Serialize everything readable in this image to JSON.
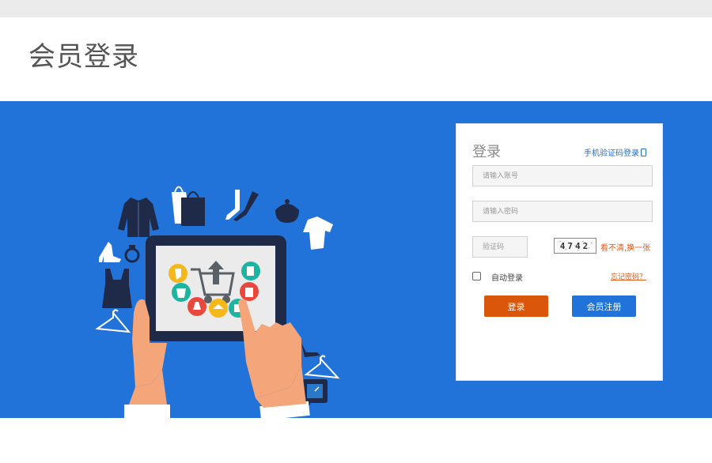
{
  "header": {
    "title": "会员登录"
  },
  "login": {
    "title": "登录",
    "sms_link": "手机验证码登录",
    "username_placeholder": "请输入账号",
    "password_placeholder": "请输入密码",
    "captcha_placeholder": "验证码",
    "captcha_text": "4742",
    "captcha_refresh": "看不清,换一张",
    "auto_login": "自动登录",
    "forgot_password": "忘记密码？",
    "login_button": "登录",
    "register_button": "会员注册"
  },
  "colors": {
    "banner": "#2173d9",
    "login_button": "#d9560a",
    "register_button": "#2173d9",
    "link": "#1f6fc6",
    "accent_link": "#e05a1a"
  },
  "icons": [
    "phone-icon",
    "checkbox",
    "shopping-cart-icon",
    "tablet-icon",
    "clothing-icon",
    "handbag-icon",
    "shoe-icon",
    "watch-icon",
    "ring-icon",
    "hanger-icon"
  ]
}
